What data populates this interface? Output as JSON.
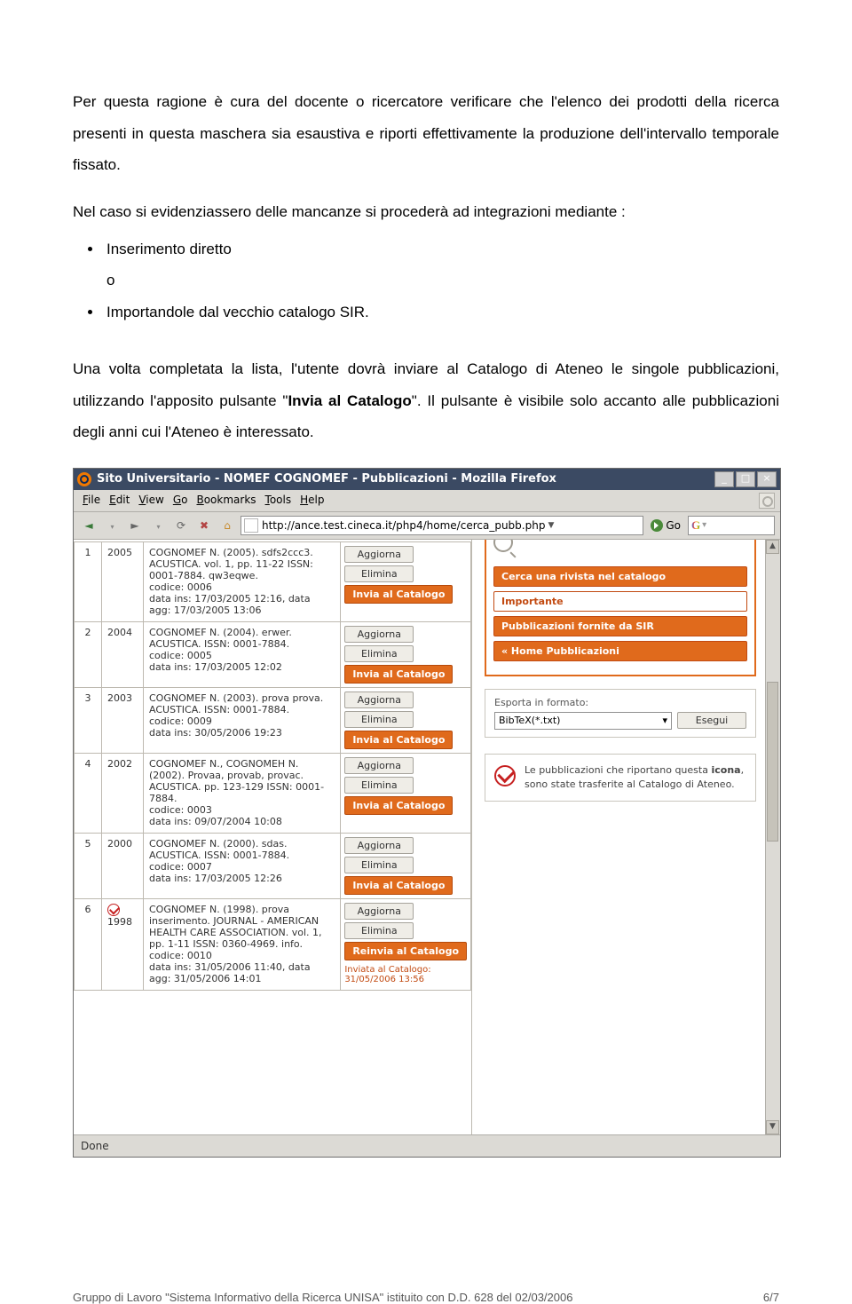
{
  "doc": {
    "para1": "Per questa ragione è cura del docente o ricercatore verificare che l'elenco dei prodotti della ricerca presenti in questa maschera sia esaustiva e riporti effettivamente la produzione dell'intervallo temporale fissato.",
    "para2": "Nel caso si evidenziassero delle mancanze si procederà ad integrazioni mediante :",
    "li1": "Inserimento diretto",
    "li_o": "o",
    "li2": "Importandole dal vecchio catalogo SIR.",
    "para3a": "Una volta completata la lista, l'utente dovrà inviare al Catalogo di Ateneo le singole pubblicazioni, utilizzando l'apposito pulsante \"",
    "para3b": "Invia al Catalogo",
    "para3c": "\". Il pulsante è visibile solo accanto alle pubblicazioni degli anni cui l'Ateneo è interessato."
  },
  "browser": {
    "title": "Sito Universitario - NOMEF COGNOMEF - Pubblicazioni - Mozilla Firefox",
    "menu": {
      "file": "File",
      "edit": "Edit",
      "view": "View",
      "go": "Go",
      "bookmarks": "Bookmarks",
      "tools": "Tools",
      "help": "Help"
    },
    "url": "http://ance.test.cineca.it/php4/home/cerca_pubb.php",
    "go": "Go",
    "search_placeholder": "G",
    "status": "Done"
  },
  "labels": {
    "aggiorna": "Aggiorna",
    "elimina": "Elimina",
    "invia": "Invia al Catalogo",
    "reinvia": "Reinvia al Catalogo",
    "sent1": "Inviata al Catalogo:",
    "sent2": "31/05/2006 13:56"
  },
  "pubs": [
    {
      "n": "1",
      "y": "2005",
      "desc": "COGNOMEF N. (2005). sdfs2ccc3. ACUSTICA. vol. 1, pp. 11-22 ISSN: 0001-7884. qw3eqwe.\ncodice: 0006\ndata ins: 17/03/2005 12:16, data agg: 17/03/2005 13:06"
    },
    {
      "n": "2",
      "y": "2004",
      "desc": "COGNOMEF N. (2004). erwer. ACUSTICA. ISSN: 0001-7884.\ncodice: 0005\ndata ins: 17/03/2005 12:02"
    },
    {
      "n": "3",
      "y": "2003",
      "desc": "COGNOMEF N. (2003). prova prova. ACUSTICA. ISSN: 0001-7884.\ncodice: 0009\ndata ins: 30/05/2006 19:23"
    },
    {
      "n": "4",
      "y": "2002",
      "desc": "COGNOMEF N., COGNOMEH N. (2002). Provaa, provab, provac. ACUSTICA. pp. 123-129 ISSN: 0001-7884.\ncodice: 0003\ndata ins: 09/07/2004 10:08"
    },
    {
      "n": "5",
      "y": "2000",
      "desc": "COGNOMEF N. (2000). sdas. ACUSTICA. ISSN: 0001-7884.\ncodice: 0007\ndata ins: 17/03/2005 12:26"
    },
    {
      "n": "6",
      "y": "1998",
      "desc": "COGNOMEF N. (1998). prova inserimento. JOURNAL - AMERICAN HEALTH CARE ASSOCIATION. vol. 1, pp. 1-11 ISSN: 0360-4969. info.\ncodice: 0010\ndata ins: 31/05/2006 11:40, data agg: 31/05/2006 14:01"
    }
  ],
  "sidebar": {
    "cerca": "Cerca una rivista nel catalogo",
    "importante": "Importante",
    "fornite": "Pubblicazioni fornite da SIR",
    "home": "« Home Pubblicazioni",
    "export_label": "Esporta in formato:",
    "export_value": "BibTeX(*.txt)",
    "export_btn": "Esegui",
    "info_text": "Le pubblicazioni che riportano questa icona, sono state trasferite al Catalogo di Ateneo.",
    "info_bold": "icona"
  },
  "footer": {
    "left": "Gruppo di Lavoro \"Sistema Informativo della Ricerca UNISA\" istituito con D.D. 628 del 02/03/2006",
    "right": "6/7"
  }
}
